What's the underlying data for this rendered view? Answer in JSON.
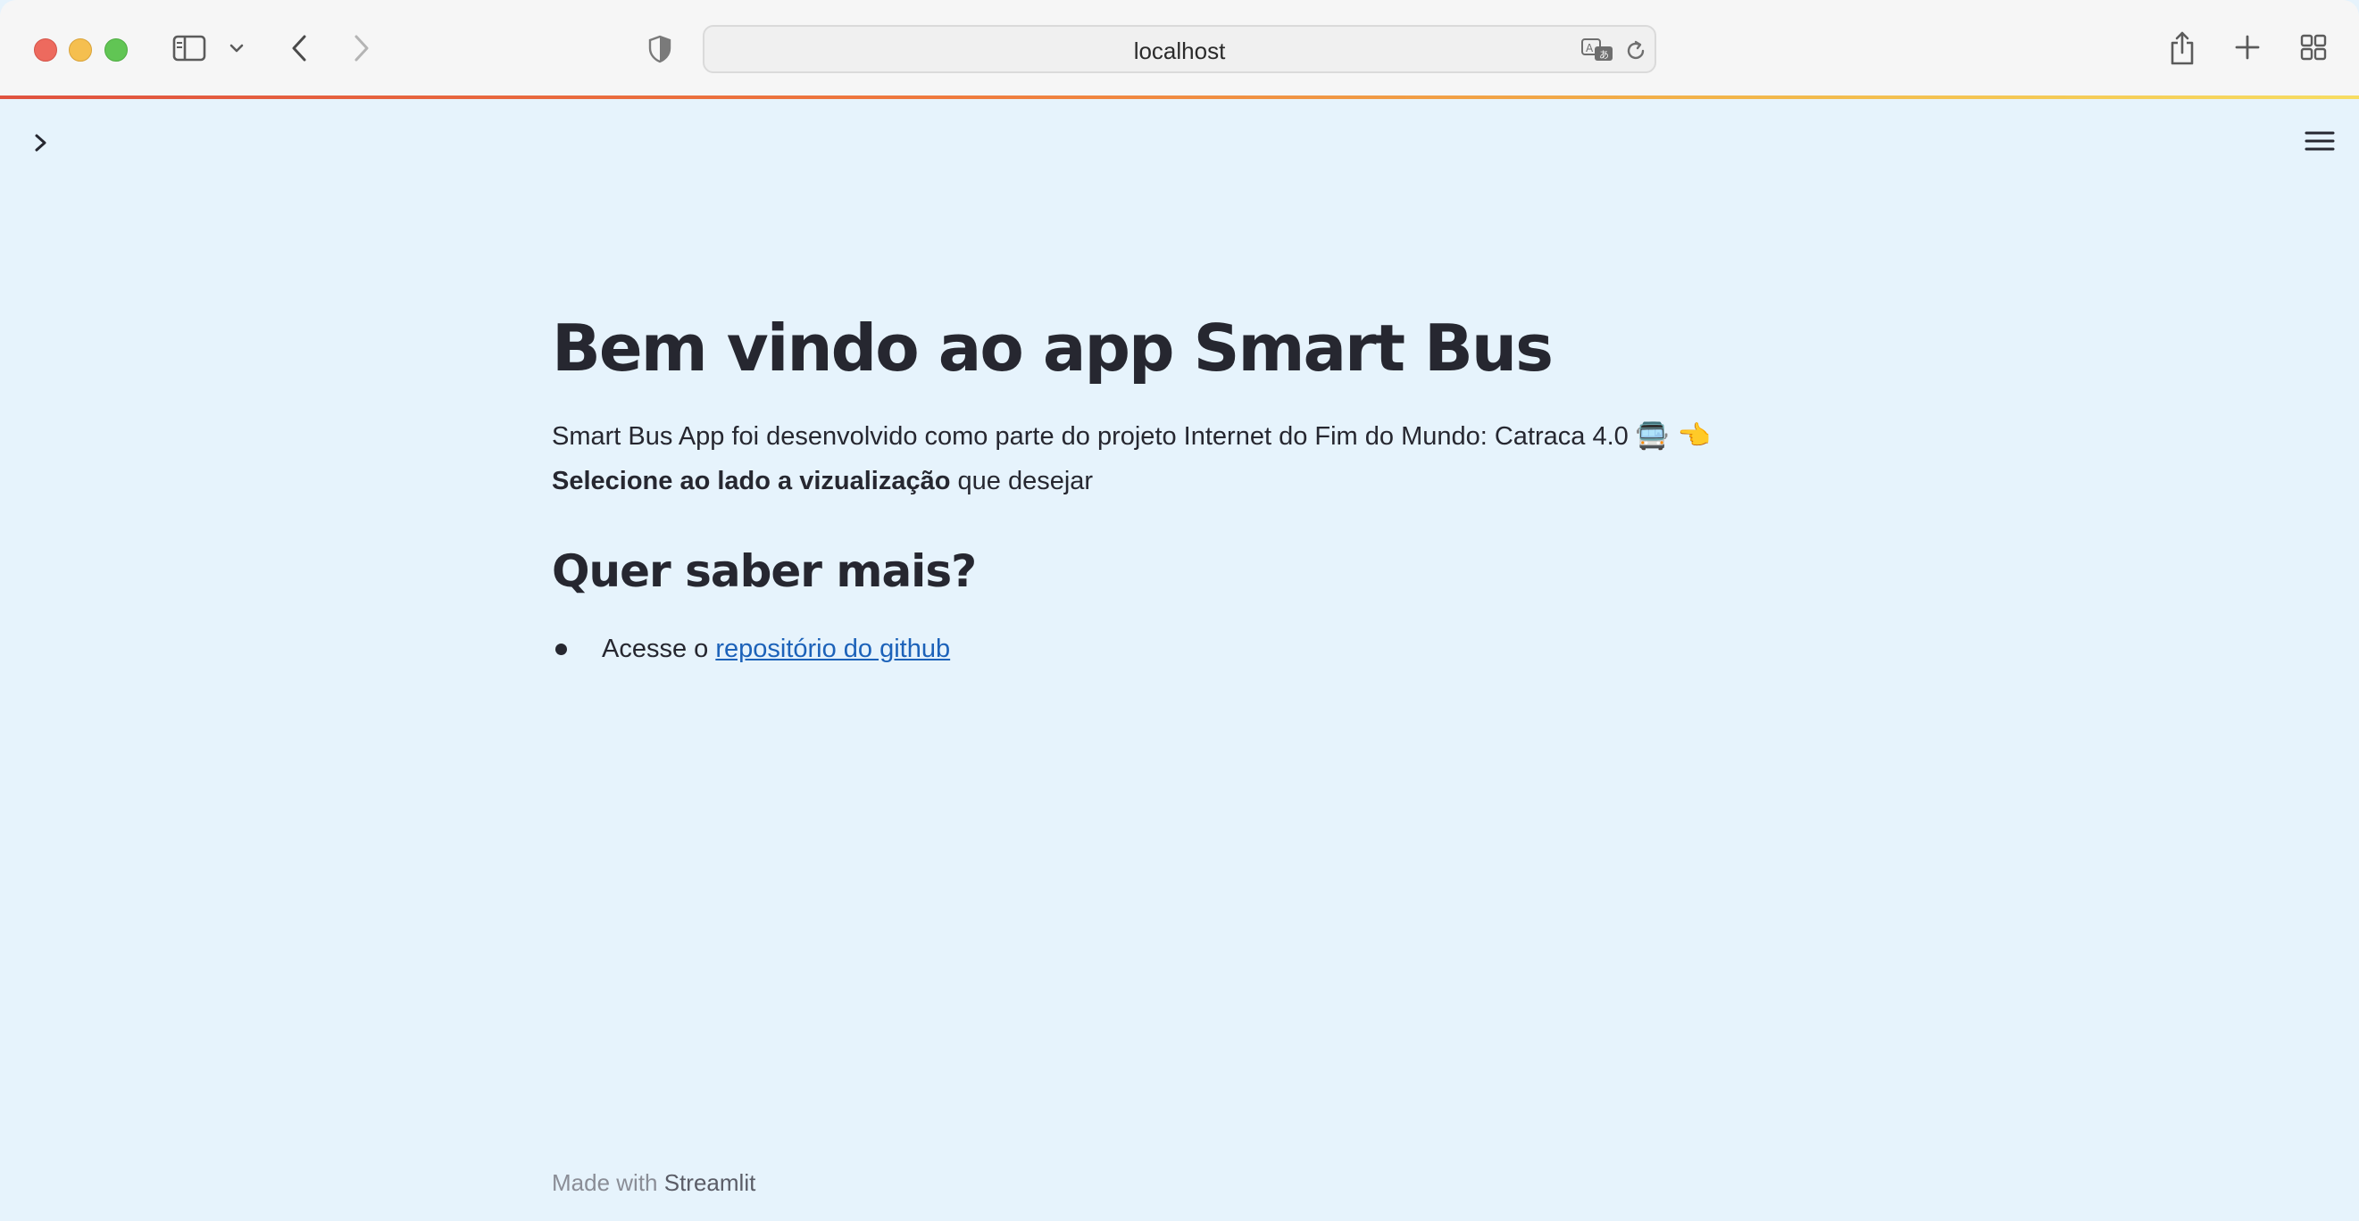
{
  "browser": {
    "address": "localhost"
  },
  "page": {
    "title": "Bem vindo ao app Smart Bus",
    "intro_text": "Smart Bus App foi desenvolvido como parte do projeto Internet do Fim do Mundo: Catraca 4.0",
    "intro_emojis": "🚍 👈",
    "select_bold": "Selecione ao lado a vizualização",
    "select_rest": " que desejar",
    "subheader": "Quer saber mais?",
    "list_item_prefix": "Acesse o ",
    "list_item_link": "repositório do github"
  },
  "footer": {
    "made_with": "Made with ",
    "brand": "Streamlit"
  },
  "icons": {
    "sidebar": "sidebar-icon",
    "chevron_down": "chevron-down-icon",
    "back": "back-icon",
    "forward": "forward-icon",
    "shield": "shield-icon",
    "translate": "translate-icon",
    "reload": "reload-icon",
    "share": "share-icon",
    "new_tab": "plus-icon",
    "tab_overview": "tab-overview-icon",
    "expand_sidebar": "chevron-right-icon",
    "main_menu": "hamburger-menu-icon"
  },
  "colors": {
    "background": "#e6f3fc",
    "text": "#262730",
    "link": "#1c62b9"
  }
}
